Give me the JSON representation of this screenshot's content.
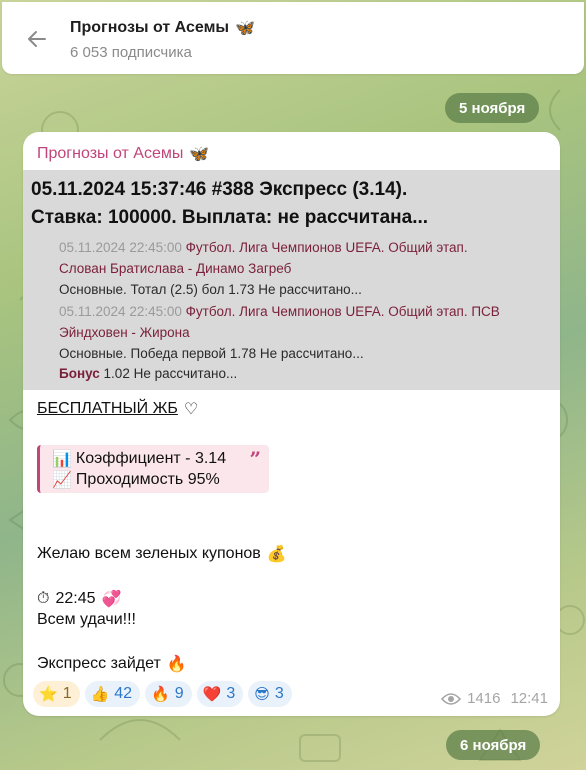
{
  "header": {
    "title": "Прогнозы от Асемы",
    "title_emoji": "🦋",
    "subscribers": "6 053 подписчика"
  },
  "dates": {
    "first": "5 ноября",
    "second": "6 ноября"
  },
  "message": {
    "author": "Прогнозы от Асемы",
    "author_emoji": "🦋",
    "coupon": {
      "headline_1": "05.11.2024 15:37:46 #388 Экспресс (3.14).",
      "headline_2": "Ставка: 100000. Выплата: не рассчитана...",
      "bets": [
        {
          "time": "05.11.2024 22:45:00",
          "event_line_1": " Футбол. Лига Чемпионов UEFA. Общий этап.",
          "event_line_2": "Слован Братислава - Динамо Загреб",
          "line": "Основные. Тотал (2.5) бол 1.73 Не рассчитано..."
        },
        {
          "time": "05.11.2024 22:45:00",
          "event_line_1": " Футбол. Лига Чемпионов UEFA. Общий этап. ПСВ",
          "event_line_2": "Эйндховен - Жирона",
          "line": "Основные. Победа первой 1.78 Не рассчитано..."
        }
      ],
      "bonus_label": "Бонус",
      "bonus_value": " 1.02 Не рассчитано..."
    },
    "free_label": "БЕСПЛАТНЫЙ ЖБ",
    "heart": "♡",
    "quote": {
      "coef_icon": "📊",
      "coef": "Коэффициент - 3.14",
      "pass_icon": "📈",
      "pass": "Проходимость 95%"
    },
    "wish": "Желаю всем зеленых купонов",
    "wish_emoji": "💰",
    "time_icon": "⏱",
    "time": "22:45",
    "time_emoji": "💞",
    "luck": "Всем удачи!!!",
    "express": "Экспресс зайдет",
    "express_emoji": "🔥",
    "reactions": [
      {
        "emoji": "⭐",
        "count": "1"
      },
      {
        "emoji": "👍",
        "count": "42"
      },
      {
        "emoji": "🔥",
        "count": "9"
      },
      {
        "emoji": "❤️",
        "count": "3"
      },
      {
        "emoji": "😎",
        "count": "3"
      }
    ],
    "views": "1416",
    "sent_time": "12:41"
  },
  "colors": {
    "accent": "#c0457a",
    "event": "#7a1f3a",
    "reaction_blue": "#2b77c9",
    "pill": "#5a7d48"
  }
}
